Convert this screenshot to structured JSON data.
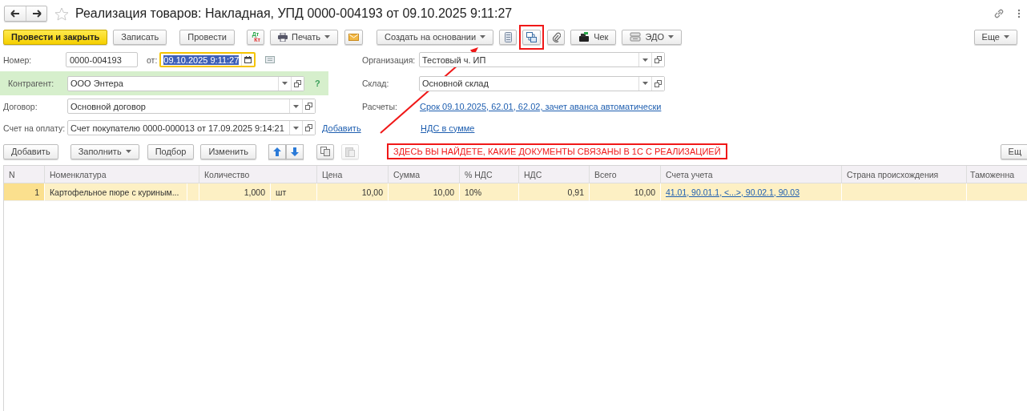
{
  "window": {
    "title": "Реализация товаров: Накладная, УПД 0000-004193 от 09.10.2025 9:11:27"
  },
  "toolbar": [
    {
      "kind": "primary",
      "label": "Провести и закрыть",
      "annotated": false
    },
    {
      "kind": "button",
      "label": "Записать",
      "annotated": false
    },
    {
      "kind": "button",
      "label": "Провести",
      "annotated": false
    },
    {
      "kind": "dtkt",
      "top": "Дт",
      "bottom": "Кт",
      "annotated": false
    },
    {
      "kind": "dropdown",
      "label": "Печать",
      "annotated": false
    },
    {
      "kind": "icon",
      "annotated": false
    },
    {
      "kind": "dropdown",
      "label": "Создать на основании",
      "annotated": false
    },
    {
      "kind": "icon",
      "annotated": false
    },
    {
      "kind": "icon",
      "annotated": true
    },
    {
      "kind": "icon",
      "annotated": false
    },
    {
      "kind": "button",
      "label": "Чек",
      "annotated": false
    },
    {
      "kind": "dropdown",
      "label": "ЭДО",
      "annotated": false
    }
  ],
  "toolbar_right": [
    {
      "kind": "dropdown",
      "label": "Еще"
    }
  ],
  "header": {
    "number_label": "Номер:",
    "number": "0000-004193",
    "date_label": "от:",
    "date": "09.10.2025  9:11:27",
    "date_focused": true,
    "date_text_selected": true
  },
  "fields_left": [
    {
      "label": "Контрагент:",
      "value": "ООО Энтера",
      "highlighted": true,
      "help": "?"
    },
    {
      "label": "Договор:",
      "value": "Основной договор",
      "highlighted": false
    },
    {
      "label": "Счет на оплату:",
      "value": "Счет покупателю 0000-000013 от 17.09.2025 9:14:21",
      "highlighted": false,
      "link": "Добавить"
    }
  ],
  "fields_right": [
    {
      "kind": "select",
      "label": "Организация:",
      "value": "Тестовый ч. ИП"
    },
    {
      "kind": "select",
      "label": "Склад:",
      "value": "Основной склад"
    },
    {
      "kind": "link",
      "label": "Расчеты:",
      "value": "Срок 09.10.2025, 62.01, 62.02, зачет аванса автоматически"
    },
    {
      "kind": "link",
      "value": "НДС в сумме"
    }
  ],
  "table_toolbar": [
    {
      "kind": "button",
      "label": "Добавить",
      "disabled": false
    },
    {
      "kind": "dropdown",
      "label": "Заполнить",
      "disabled": false
    },
    {
      "kind": "button",
      "label": "Подбор",
      "disabled": false
    },
    {
      "kind": "button",
      "label": "Изменить",
      "disabled": false
    },
    {
      "kind": "icon",
      "disabled": false
    },
    {
      "kind": "icon",
      "disabled": false
    },
    {
      "kind": "icon",
      "disabled": false
    },
    {
      "kind": "icon",
      "disabled": true
    }
  ],
  "annotation": {
    "text": "ЗДЕСЬ ВЫ НАЙДЕТЕ, КАКИЕ ДОКУМЕНТЫ СВЯЗАНЫ В 1С С РЕАЛИЗАЦИЕЙ"
  },
  "table_toolbar_right": [
    {
      "kind": "button",
      "label": "Ещ"
    }
  ],
  "table": {
    "columns": [
      "N",
      "Номенклатура",
      "Количество",
      "Цена",
      "Сумма",
      "% НДС",
      "НДС",
      "Всего",
      "Счета учета",
      "Страна происхождения",
      "Таможенна"
    ],
    "rows": [
      {
        "selected": true,
        "n": "1",
        "nomenclature": "Картофельное пюре с куриным...",
        "quantity": "1,000",
        "unit": "шт",
        "price": "10,00",
        "sum": "10,00",
        "vat_rate": "10%",
        "vat": "0,91",
        "total": "10,00",
        "accounts": "41.01, 90.01.1, <...>, 90.02.1, 90.03"
      }
    ]
  }
}
